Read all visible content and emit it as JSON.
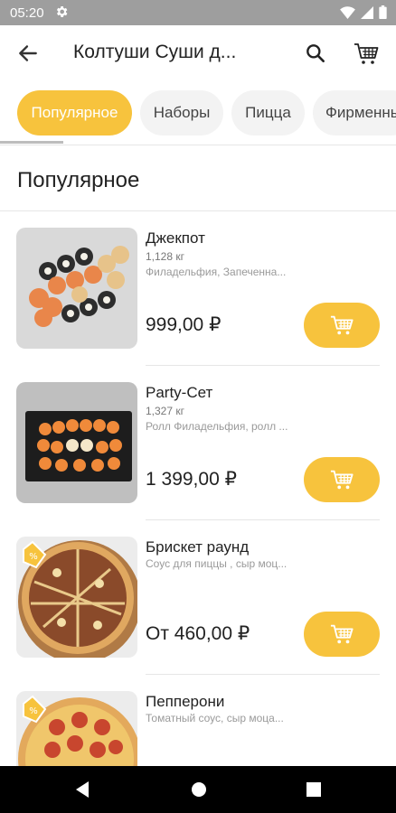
{
  "status_bar": {
    "time": "05:20"
  },
  "app_bar": {
    "title": "Колтуши Суши д..."
  },
  "categories": [
    {
      "label": "Популярное",
      "active": true
    },
    {
      "label": "Наборы",
      "active": false
    },
    {
      "label": "Пицца",
      "active": false
    },
    {
      "label": "Фирменные",
      "active": false
    }
  ],
  "section": {
    "title": "Популярное"
  },
  "products": [
    {
      "name": "Джекпот",
      "weight": "1,128 кг",
      "description": "Филадельфия, Запеченна...",
      "price": "999,00 ₽",
      "badge": false
    },
    {
      "name": "Party-Сет",
      "weight": "1,327 кг",
      "description": "Ролл Филадельфия, ролл ...",
      "price": "1 399,00 ₽",
      "badge": false
    },
    {
      "name": "Брискет раунд",
      "weight": "",
      "description": "Соус для пиццы , сыр моц...",
      "price": "От 460,00 ₽",
      "badge": true
    },
    {
      "name": "Пепперони",
      "weight": "",
      "description": "Томатный соус, сыр моца...",
      "price": "",
      "badge": true
    }
  ],
  "colors": {
    "accent": "#f7c33d",
    "status_bar": "#9e9e9e",
    "nav_bar": "#000000"
  }
}
